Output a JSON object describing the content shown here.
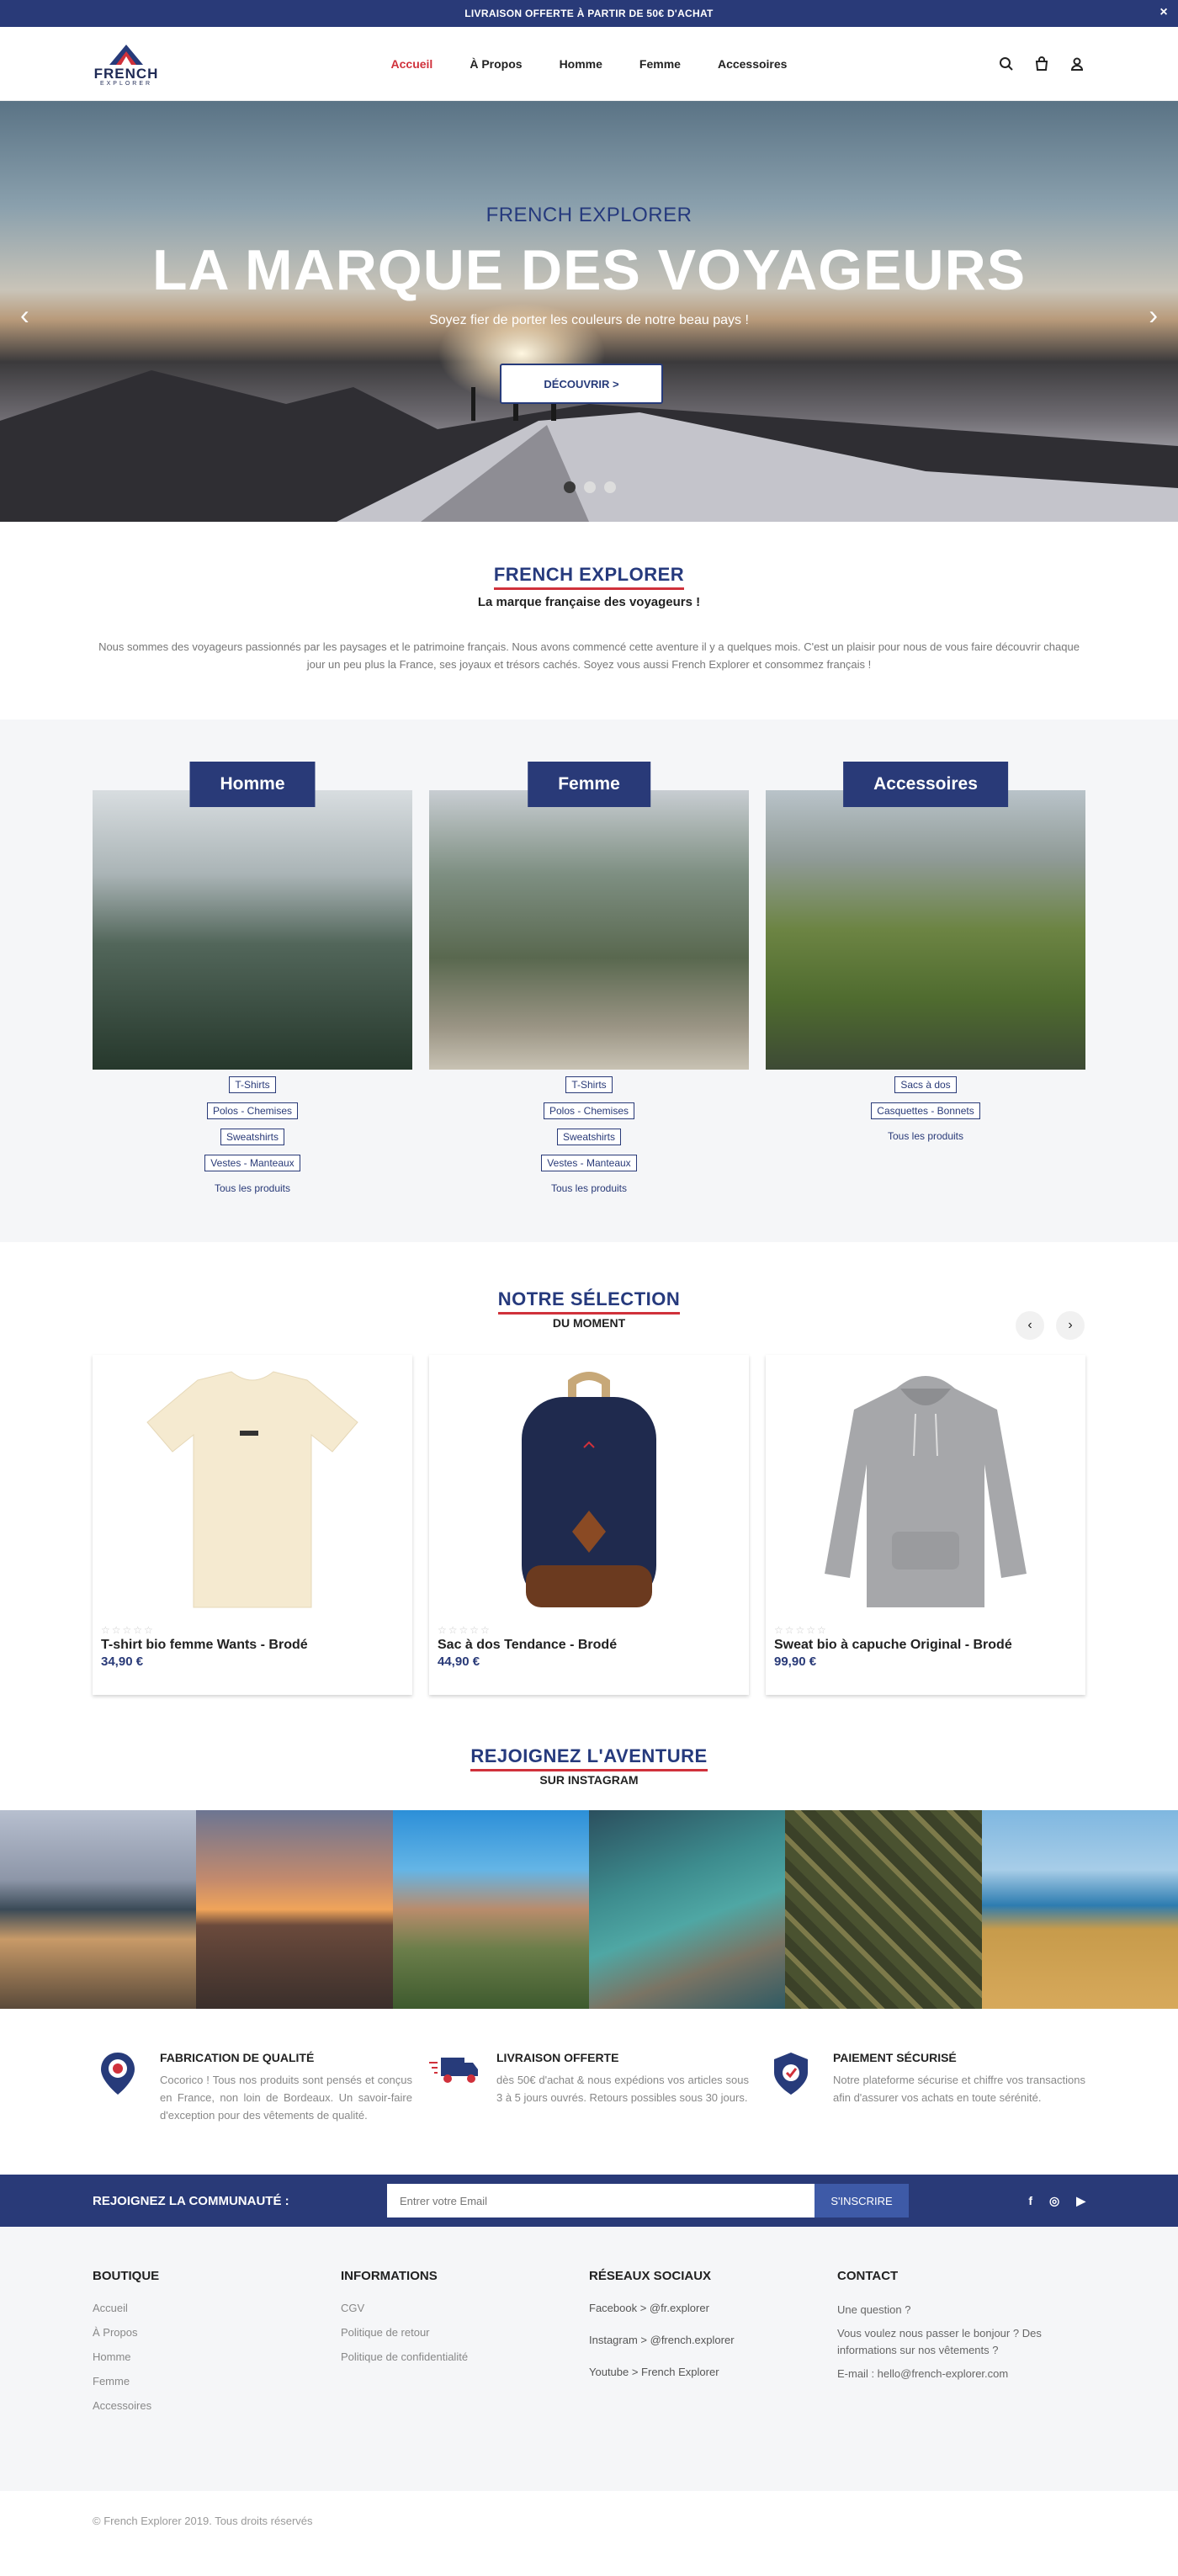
{
  "topbar": {
    "text": "LIVRAISON OFFERTE À PARTIR DE 50€ D'ACHAT",
    "close": "×"
  },
  "logo": {
    "line1": "FRENCH",
    "line2": "EXPLORER"
  },
  "nav": [
    "Accueil",
    "À Propos",
    "Homme",
    "Femme",
    "Accessoires"
  ],
  "hero": {
    "subtitle": "FRENCH EXPLORER",
    "title": "LA MARQUE DES VOYAGEURS",
    "tagline": "Soyez fier de porter les couleurs de notre beau pays !",
    "button": "DÉCOUVRIR >"
  },
  "about": {
    "title": "FRENCH EXPLORER",
    "subtitle": "La marque française des voyageurs !",
    "text": "Nous sommes des voyageurs passionnés par les paysages et le patrimoine français. Nous avons commencé cette aventure il y a quelques mois. C'est un plaisir pour nous de vous faire découvrir chaque jour un peu plus la France, ses joyaux et trésors cachés. Soyez vous aussi French Explorer et consommez français !"
  },
  "categories": [
    {
      "label": "Homme",
      "links": [
        "T-Shirts",
        "Polos - Chemises",
        "Sweatshirts",
        "Vestes - Manteaux"
      ],
      "all": "Tous les produits"
    },
    {
      "label": "Femme",
      "links": [
        "T-Shirts",
        "Polos - Chemises",
        "Sweatshirts",
        "Vestes - Manteaux"
      ],
      "all": "Tous les produits"
    },
    {
      "label": "Accessoires",
      "links": [
        "Sacs à dos",
        "Casquettes - Bonnets"
      ],
      "all": "Tous les produits"
    }
  ],
  "selection": {
    "title": "NOTRE SÉLECTION",
    "subtitle": "DU MOMENT",
    "prev": "‹",
    "next": "›",
    "products": [
      {
        "name": "T-shirt bio femme Wants - Brodé",
        "price": "34,90 €",
        "stars": "☆☆☆☆☆"
      },
      {
        "name": "Sac à dos Tendance - Brodé",
        "price": "44,90 €",
        "stars": "☆☆☆☆☆"
      },
      {
        "name": "Sweat bio à capuche Original - Brodé",
        "price": "99,90 €",
        "stars": "☆☆☆☆☆"
      }
    ]
  },
  "instagram": {
    "title": "REJOIGNEZ L'AVENTURE",
    "subtitle": "SUR INSTAGRAM"
  },
  "features": [
    {
      "title": "FABRICATION DE QUALITÉ",
      "text": "Cocorico ! Tous nos produits sont pensés et conçus en France, non loin de Bordeaux. Un savoir-faire d'exception pour des vêtements de qualité."
    },
    {
      "title": "LIVRAISON OFFERTE",
      "text": "dès 50€ d'achat & nous expédions vos articles sous 3 à 5 jours ouvrés. Retours possibles sous 30 jours."
    },
    {
      "title": "PAIEMENT SÉCURISÉ",
      "text": "Notre plateforme sécurise et chiffre vos transactions afin d'assurer vos achats en toute sérénité."
    }
  ],
  "newsletter": {
    "label": "REJOIGNEZ LA COMMUNAUTÉ :",
    "placeholder": "Entrer votre Email",
    "button": "S'INSCRIRE",
    "social": [
      "f",
      "◎",
      "▶"
    ]
  },
  "footer": {
    "boutique": {
      "title": "BOUTIQUE",
      "items": [
        "Accueil",
        "À Propos",
        "Homme",
        "Femme",
        "Accessoires"
      ]
    },
    "informations": {
      "title": "INFORMATIONS",
      "items": [
        "CGV",
        "Politique de retour",
        "Politique de confidentialité"
      ]
    },
    "reseaux": {
      "title": "RÉSEAUX SOCIAUX",
      "items": [
        "Facebook > @fr.explorer",
        "Instagram > @french.explorer",
        "Youtube > French Explorer"
      ]
    },
    "contact": {
      "title": "CONTACT",
      "items": [
        "Une question ?",
        "Vous voulez nous passer le bonjour ? Des informations sur nos vêtements ?",
        "E-mail : hello@french-explorer.com"
      ]
    }
  },
  "copyright": "© French Explorer 2019. Tous droits réservés"
}
